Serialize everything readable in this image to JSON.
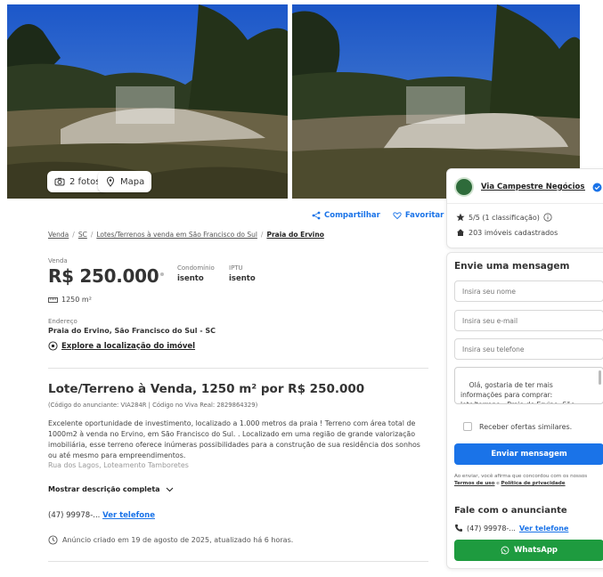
{
  "gallery": {
    "photos_label": "2 fotos",
    "map_label": "Mapa"
  },
  "actions": {
    "share_label": "Compartilhar",
    "favorite_label": "Favoritar"
  },
  "breadcrumb": {
    "items": [
      "Venda",
      "SC",
      "Lotes/Terrenos à venda em São Francisco do Sul",
      "Praia do Ervino"
    ]
  },
  "price": {
    "label": "Venda",
    "value": "R$ 250.000",
    "condo_label": "Condomínio",
    "condo_value": "isento",
    "iptu_label": "IPTU",
    "iptu_value": "isento"
  },
  "area": "1250 m²",
  "address": {
    "label": "Endereço",
    "value": "Praia do Ervino, São Francisco do Sul - SC",
    "explore_label": "Explore a localização do imóvel"
  },
  "listing": {
    "title": "Lote/Terreno à Venda, 1250 m² por R$ 250.000",
    "codes": "(Código do anunciante: VIA284R | Código no Viva Real: 2829864329)",
    "description": "Excelente oportunidade de investimento, localizado a 1.000 metros da praia ! Terreno com área total de 1000m2 à venda no Ervino, em São Francisco do Sul. . Localizado em uma região de grande valorização imobiliária, esse terreno oferece inúmeras possibilidades para a construção de sua residência dos sonhos ou até mesmo para empreendimentos.",
    "description_faded": "Rua dos Lagos, Loteamento Tamboretes",
    "show_more": "Mostrar descrição completa",
    "phone_partial": "(47) 99978-...",
    "see_phone": "Ver telefone",
    "created": "Anúncio criado em 19 de agosto de 2025, atualizado há 6 horas."
  },
  "advertiser": {
    "name": "Via Campestre Negócios I...",
    "rating": "5/5 (1 classificação)",
    "listings": "203 imóveis cadastrados"
  },
  "contact": {
    "title": "Envie uma mensagem",
    "name_placeholder": "Insira seu nome",
    "email_placeholder": "Insira seu e-mail",
    "phone_placeholder": "Insira seu telefone",
    "message": "Olá, gostaria de ter mais informações para comprar: lote/terreno - Praia do Ervino, São Francisco do Sul + SC que encontrei",
    "similar_offers": "Receber ofertas similares.",
    "send_button": "Enviar mensagem",
    "terms_prefix": "Ao enviar, você afirma que concordou com os nossos",
    "terms_link": "Termos de uso",
    "terms_and": "e",
    "privacy_link": "Política de privacidade",
    "talk_title": "Fale com o anunciante",
    "phone_partial": "(47) 99978-...",
    "see_phone": "Ver telefone",
    "whatsapp": "WhatsApp"
  },
  "colors": {
    "accent": "#1a73e8",
    "whatsapp": "#1e9b3f"
  }
}
